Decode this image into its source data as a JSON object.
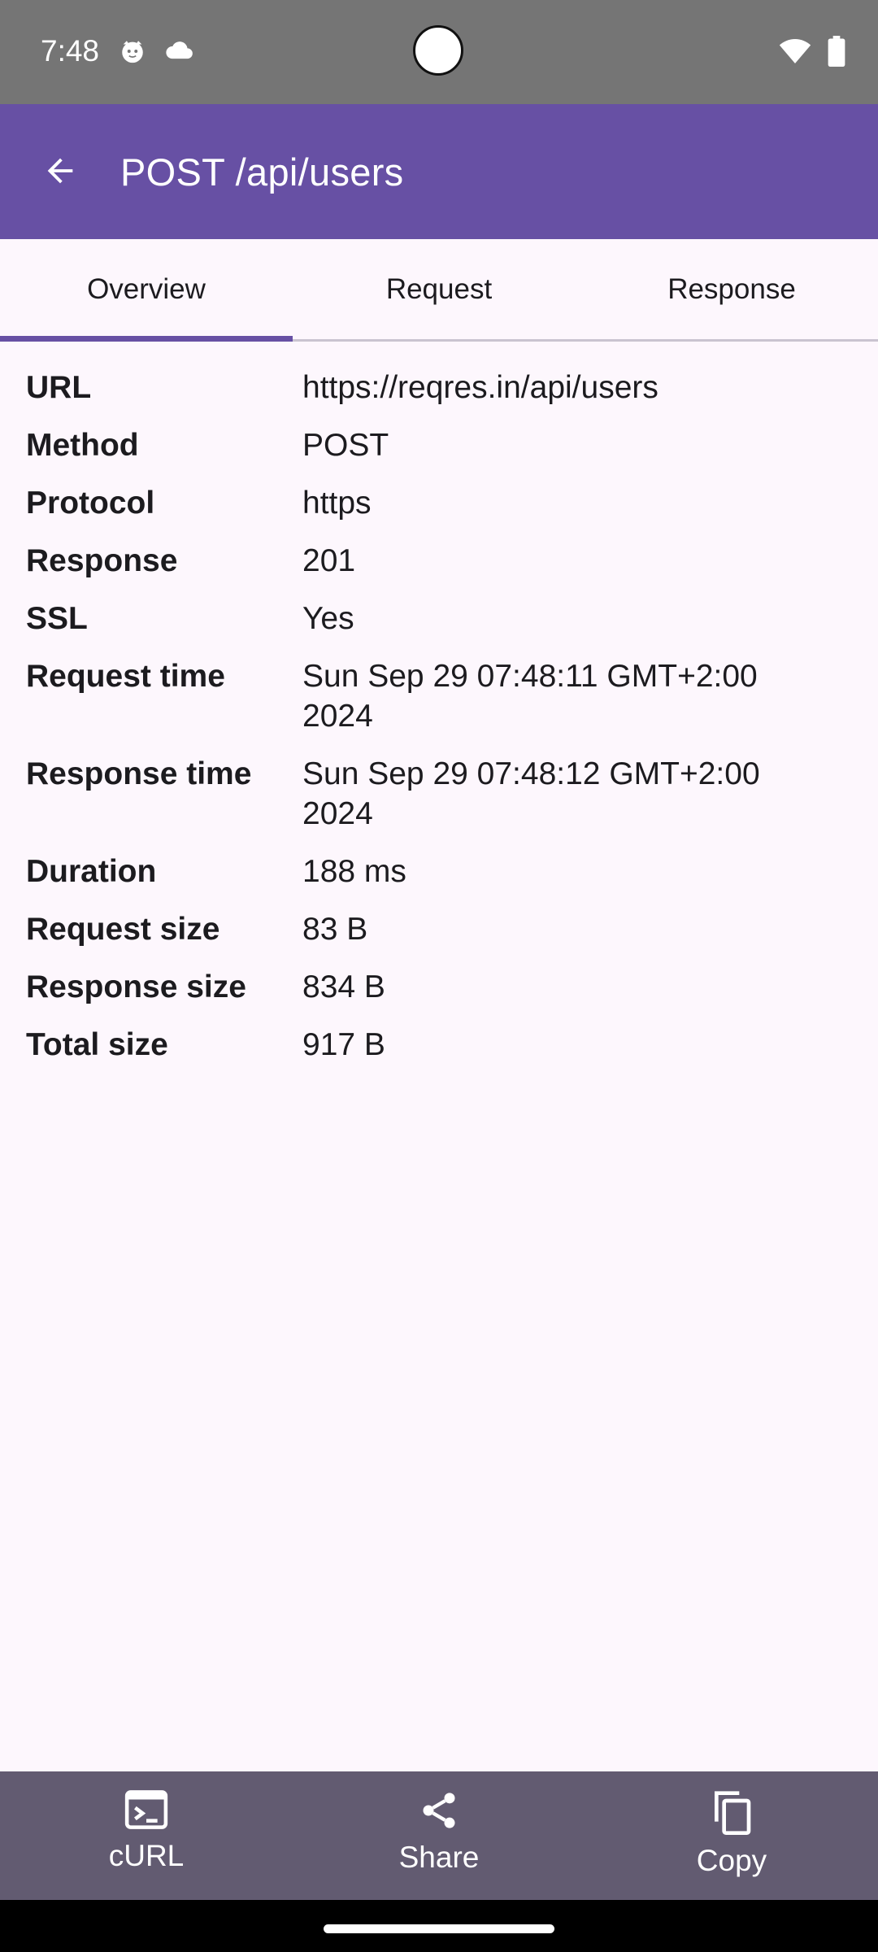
{
  "status_bar": {
    "time": "7:48",
    "left_icons": [
      "cat-face-notification-icon",
      "cloud-icon"
    ],
    "right_icons": [
      "wifi-icon",
      "battery-icon"
    ]
  },
  "app_bar": {
    "back_icon": "arrow-back-icon",
    "title": "POST /api/users"
  },
  "tabs": [
    {
      "label": "Overview",
      "active": true
    },
    {
      "label": "Request",
      "active": false
    },
    {
      "label": "Response",
      "active": false
    }
  ],
  "overview": {
    "rows": [
      {
        "label": "URL",
        "value": "https://reqres.in/api/users"
      },
      {
        "label": "Method",
        "value": "POST"
      },
      {
        "label": "Protocol",
        "value": "https"
      },
      {
        "label": "Response",
        "value": "201"
      },
      {
        "label": "SSL",
        "value": "Yes"
      },
      {
        "label": "Request time",
        "value": "Sun Sep 29 07:48:11 GMT+2:00 2024"
      },
      {
        "label": "Response time",
        "value": "Sun Sep 29 07:48:12 GMT+2:00 2024"
      },
      {
        "label": "Duration",
        "value": "188 ms"
      },
      {
        "label": "Request size",
        "value": "83 B"
      },
      {
        "label": "Response size",
        "value": "834 B"
      },
      {
        "label": "Total size",
        "value": "917 B"
      }
    ]
  },
  "bottom_actions": [
    {
      "label": "cURL",
      "icon": "terminal-icon"
    },
    {
      "label": "Share",
      "icon": "share-icon"
    },
    {
      "label": "Copy",
      "icon": "copy-icon"
    }
  ],
  "colors": {
    "primary": "#6750a4",
    "status_bar": "#757575",
    "bottom_bar": "#625b71",
    "background": "#fdf7fd"
  }
}
